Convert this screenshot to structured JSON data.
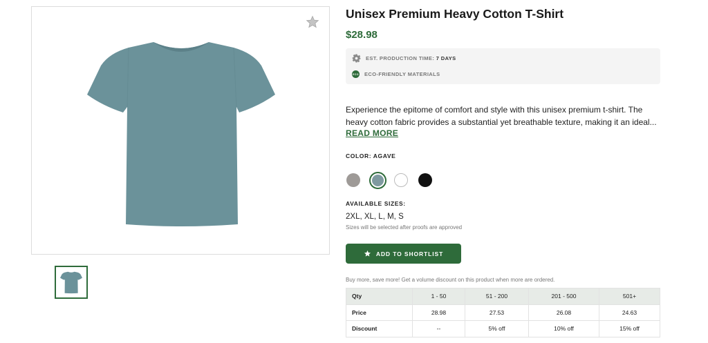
{
  "product": {
    "title": "Unisex Premium Heavy Cotton T-Shirt",
    "price": "$28.98",
    "shirt_color_hex": "#6b929a"
  },
  "production": {
    "est_label": "EST. PRODUCTION TIME:",
    "est_value": "7 DAYS",
    "eco_badge": "ECO",
    "eco_label": "ECO-FRIENDLY MATERIALS",
    "icons": [
      "gear-icon",
      "eco-icon"
    ]
  },
  "description": {
    "line1": "Experience the epitome of comfort and style with this unisex premium t-shirt. The",
    "line2": "heavy cotton fabric provides a substantial yet breathable texture, making it an ideal...",
    "read_more": "READ MORE"
  },
  "color": {
    "label": "COLOR: AGAVE",
    "swatches": [
      {
        "name": "gray",
        "hex": "#9e9a97",
        "selected": false
      },
      {
        "name": "agave",
        "hex": "#7f9aa0",
        "selected": true
      },
      {
        "name": "white",
        "hex": "#ffffff",
        "selected": false
      },
      {
        "name": "black",
        "hex": "#111111",
        "selected": false
      }
    ]
  },
  "sizes": {
    "label": "AVAILABLE SIZES:",
    "value": "2XL, XL, L, M, S",
    "note": "Sizes will be selected after proofs are approved"
  },
  "shortlist": {
    "label": "ADD TO SHORTLIST",
    "icon": "star-icon"
  },
  "volume": {
    "note": "Buy more, save more! Get a volume discount on this product when more are ordered.",
    "header": [
      "Qty",
      "1 - 50",
      "51 - 200",
      "201 - 500",
      "501+"
    ],
    "price_row": [
      "Price",
      "28.98",
      "27.53",
      "26.08",
      "24.63"
    ],
    "discount_row": [
      "Discount",
      "--",
      "5% off",
      "10% off",
      "15% off"
    ]
  },
  "colors": {
    "accent": "#2e6b3a",
    "table_header_bg": "#e7ebe7",
    "panel_bg": "#f4f4f4"
  }
}
